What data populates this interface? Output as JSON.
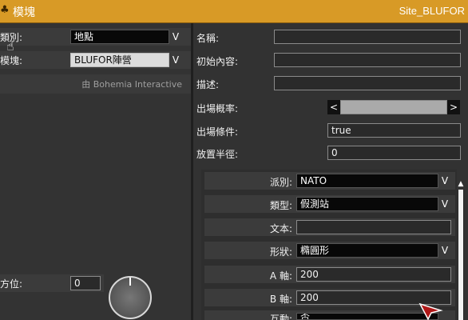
{
  "titlebar": {
    "title": "模塊",
    "right_text": "Site_BLUFOR"
  },
  "left": {
    "category_label": "類別:",
    "category_value": "地點",
    "module_label": "模塊:",
    "module_value": "BLUFOR陣營",
    "credit": "由 Bohemia Interactive",
    "bearing_label": "方位:",
    "bearing_value": "0"
  },
  "right": {
    "name_label": "名稱:",
    "name_value": "",
    "init_label": "初始內容:",
    "init_value": "",
    "desc_label": "描述:",
    "desc_value": "",
    "prob_label": "出場概率:",
    "prob_left": "<",
    "prob_right": ">",
    "prob_value": 0.9,
    "cond_label": "出場條件:",
    "cond_value": "true",
    "radius_label": "放置半徑:",
    "radius_value": "0"
  },
  "attrs": {
    "faction_label": "派別:",
    "faction_value": "NATO",
    "type_label": "類型:",
    "type_value": "假測站",
    "text_label": "文本:",
    "text_value": "",
    "shape_label": "形狀:",
    "shape_value": "橢圓形",
    "a_label": "A 軸:",
    "a_value": "200",
    "b_label": "B 軸:",
    "b_value": "200",
    "mutual_label": "互動:",
    "mutual_value": "否"
  },
  "icons": {
    "dropdown": "chevron-down-icon",
    "title": "module-icon"
  },
  "arrow_glyph": "V",
  "colors": {
    "titlebar": "#d89a26",
    "panel": "#333333",
    "dropdown_bg": "#080808"
  }
}
